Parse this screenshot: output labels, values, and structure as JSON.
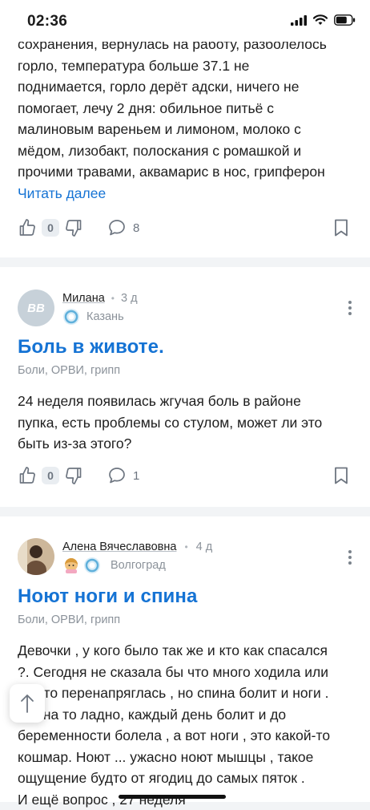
{
  "status_bar": {
    "time": "02:36"
  },
  "post1": {
    "text": "сохранения, вернулась на работу, разболелось горло, температура больше 37.1 не поднимается, горло дерёт адски, ничего не помогает, лечу 2 дня: обильное питьё с малиновым вареньем и лимоном, молоко с мёдом, лизобакт, полоскания с ромашкой и прочими травами, аквамарис в нос, грипферон",
    "lines": [
      "сохранения, вернулась на работу, разболелось",
      "горло, температура больше 37.1 не",
      "поднимается, горло дерёт адски, ничего не",
      "помогает, лечу 2 дня: обильное питьё с",
      "малиновым вареньем и лимоном, молоко с",
      "мёдом, лизобакт, полоскания с ромашкой и",
      "прочими травами, аквамарис в нос, грипферон"
    ],
    "read_more": "Читать далее",
    "likes": "0",
    "comments": "8"
  },
  "post2": {
    "avatar_initials": "ВВ",
    "author": "Милана",
    "time_ago": "3 д",
    "city": "Казань",
    "title": "Боль в животе.",
    "tags": "Боли, ОРВИ, грипп",
    "lines": [
      "24 неделя появилась жгучая боль в районе",
      "пупка, есть проблемы со стулом, может ли это",
      "быть из-за этого?"
    ],
    "likes": "0",
    "comments": "1"
  },
  "post3": {
    "author": "Алена Вячеславовна",
    "time_ago": "4 д",
    "city": "Волгоград",
    "title": "Ноют ноги и спина",
    "tags": "Боли, ОРВИ, грипп",
    "lines": [
      "Девочки , у кого было так же и кто как спасался",
      "?. Сегодня не сказала бы что много ходила или",
      "что-то перенапряглась , но спина болит и ноги .",
      "Спина то ладно, каждый день болит и до",
      "беременности болела , а вот ноги , это какой-то",
      "кошмар. Ноют ... ужасно ноют мышцы , такое",
      "ощущение будто от ягодиц до самых пяток .",
      "И ещё вопрос , 27 неделя"
    ]
  },
  "colors": {
    "accent": "#1573d4",
    "muted": "#8b929a",
    "background": "#f2f4f6"
  },
  "icons": [
    "like-icon",
    "dislike-icon",
    "comment-icon",
    "bookmark-icon",
    "more-icon",
    "arrow-up-icon",
    "wifi-icon",
    "battery-icon",
    "signal-icon"
  ]
}
